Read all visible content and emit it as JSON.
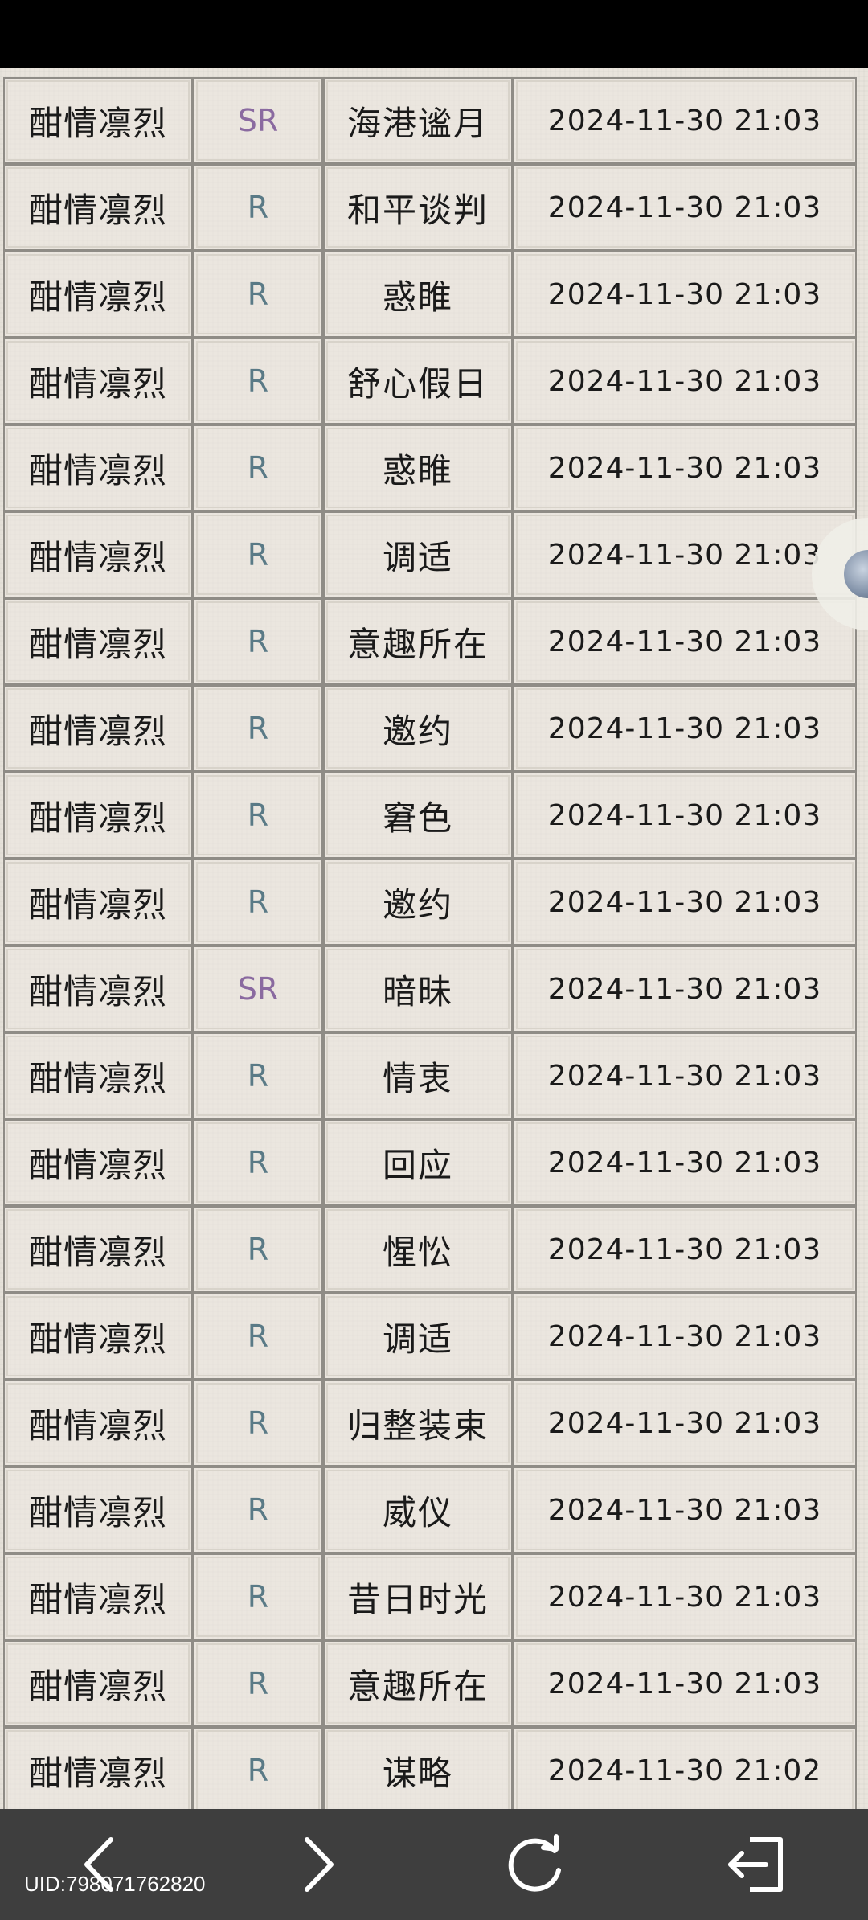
{
  "uid_label": "UID:798071762820",
  "records": [
    {
      "name": "酣情凛烈",
      "rarity": "SR",
      "item": "海港谧月",
      "time": "2024-11-30 21:03"
    },
    {
      "name": "酣情凛烈",
      "rarity": "R",
      "item": "和平谈判",
      "time": "2024-11-30 21:03"
    },
    {
      "name": "酣情凛烈",
      "rarity": "R",
      "item": "惑睢",
      "time": "2024-11-30 21:03"
    },
    {
      "name": "酣情凛烈",
      "rarity": "R",
      "item": "舒心假日",
      "time": "2024-11-30 21:03"
    },
    {
      "name": "酣情凛烈",
      "rarity": "R",
      "item": "惑睢",
      "time": "2024-11-30 21:03"
    },
    {
      "name": "酣情凛烈",
      "rarity": "R",
      "item": "调适",
      "time": "2024-11-30 21:03"
    },
    {
      "name": "酣情凛烈",
      "rarity": "R",
      "item": "意趣所在",
      "time": "2024-11-30 21:03"
    },
    {
      "name": "酣情凛烈",
      "rarity": "R",
      "item": "邀约",
      "time": "2024-11-30 21:03"
    },
    {
      "name": "酣情凛烈",
      "rarity": "R",
      "item": "窘色",
      "time": "2024-11-30 21:03"
    },
    {
      "name": "酣情凛烈",
      "rarity": "R",
      "item": "邀约",
      "time": "2024-11-30 21:03"
    },
    {
      "name": "酣情凛烈",
      "rarity": "SR",
      "item": "暗昧",
      "time": "2024-11-30 21:03"
    },
    {
      "name": "酣情凛烈",
      "rarity": "R",
      "item": "情衷",
      "time": "2024-11-30 21:03"
    },
    {
      "name": "酣情凛烈",
      "rarity": "R",
      "item": "回应",
      "time": "2024-11-30 21:03"
    },
    {
      "name": "酣情凛烈",
      "rarity": "R",
      "item": "惺忪",
      "time": "2024-11-30 21:03"
    },
    {
      "name": "酣情凛烈",
      "rarity": "R",
      "item": "调适",
      "time": "2024-11-30 21:03"
    },
    {
      "name": "酣情凛烈",
      "rarity": "R",
      "item": "归整装束",
      "time": "2024-11-30 21:03"
    },
    {
      "name": "酣情凛烈",
      "rarity": "R",
      "item": "威仪",
      "time": "2024-11-30 21:03"
    },
    {
      "name": "酣情凛烈",
      "rarity": "R",
      "item": "昔日时光",
      "time": "2024-11-30 21:03"
    },
    {
      "name": "酣情凛烈",
      "rarity": "R",
      "item": "意趣所在",
      "time": "2024-11-30 21:03"
    },
    {
      "name": "酣情凛烈",
      "rarity": "R",
      "item": "谋略",
      "time": "2024-11-30 21:02"
    }
  ],
  "nav": {
    "back_icon": "chevron-left-icon",
    "forward_icon": "chevron-right-icon",
    "refresh_icon": "refresh-icon",
    "exit_icon": "exit-icon"
  },
  "colors": {
    "rarity_R": "#5a7a86",
    "rarity_SR": "#8a6aa0",
    "navbar_bg": "#3e3e3e",
    "page_bg": "#e9e4dc"
  }
}
